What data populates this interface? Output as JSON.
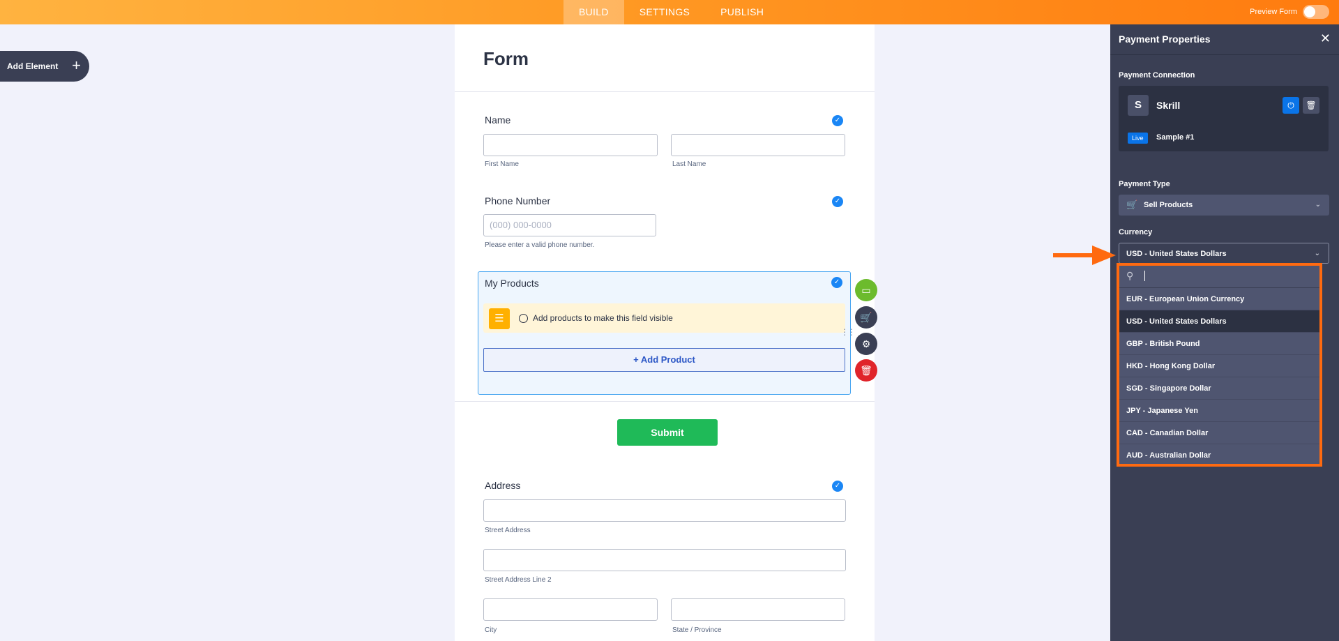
{
  "topbar": {
    "tabs": [
      {
        "label": "BUILD",
        "active": true
      },
      {
        "label": "SETTINGS",
        "active": false
      },
      {
        "label": "PUBLISH",
        "active": false
      }
    ],
    "preview_label": "Preview Form"
  },
  "sidebar": {
    "add_element_label": "Add Element",
    "add_icon": "+"
  },
  "form": {
    "title": "Form",
    "name": {
      "label": "Name",
      "first": "First Name",
      "last": "Last Name"
    },
    "phone": {
      "label": "Phone Number",
      "placeholder": "(000) 000-0000",
      "hint": "Please enter a valid phone number."
    },
    "products": {
      "label": "My Products",
      "notice": "Add products to make this field visible",
      "add_button": "+ Add Product"
    },
    "submit": "Submit",
    "address": {
      "label": "Address",
      "street": "Street Address",
      "street2": "Street Address Line 2",
      "city": "City",
      "state": "State / Province"
    }
  },
  "panel": {
    "title": "Payment Properties",
    "close": "✕",
    "connection_label": "Payment Connection",
    "gateway_logo": "S",
    "gateway_name": "Skrill",
    "mode_badge": "Live",
    "account_name": "Sample #1",
    "payment_type_label": "Payment Type",
    "payment_type_value": "Sell Products",
    "currency_label": "Currency",
    "currency_value": "USD - United States Dollars"
  },
  "currency_dropdown": {
    "options": [
      {
        "label": "EUR - European Union Currency",
        "selected": false
      },
      {
        "label": "USD - United States Dollars",
        "selected": true
      },
      {
        "label": "GBP - British Pound",
        "selected": false
      },
      {
        "label": "HKD - Hong Kong Dollar",
        "selected": false
      },
      {
        "label": "SGD - Singapore Dollar",
        "selected": false
      },
      {
        "label": "JPY - Japanese Yen",
        "selected": false
      },
      {
        "label": "CAD - Canadian Dollar",
        "selected": false
      },
      {
        "label": "AUD - Australian Dollar",
        "selected": false
      }
    ]
  },
  "colors": {
    "accent_orange": "#ff7b0f",
    "panel_bg": "#3a3f54",
    "check_blue": "#1a86f5",
    "submit_green": "#1fba58",
    "highlight": "#ff6a10"
  }
}
